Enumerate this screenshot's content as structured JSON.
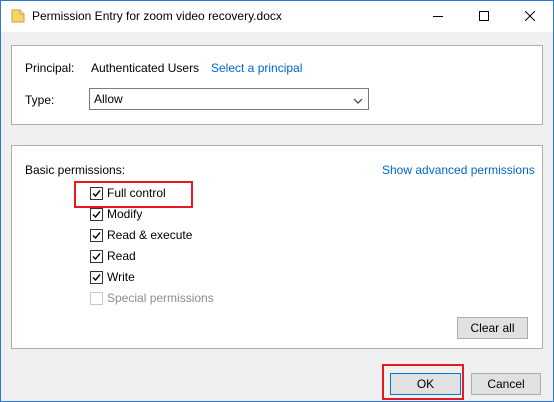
{
  "window": {
    "title": "Permission Entry for zoom video recovery.docx",
    "icons": {
      "app": "file-icon",
      "minimize": "minimize-icon",
      "maximize": "maximize-icon",
      "close": "close-icon"
    }
  },
  "principal": {
    "label": "Principal:",
    "value": "Authenticated Users",
    "link": "Select a principal"
  },
  "type": {
    "label": "Type:",
    "selected": "Allow"
  },
  "permissions": {
    "label": "Basic permissions:",
    "advanced_link": "Show advanced permissions",
    "items": [
      {
        "label": "Full control",
        "checked": true,
        "enabled": true
      },
      {
        "label": "Modify",
        "checked": true,
        "enabled": true
      },
      {
        "label": "Read & execute",
        "checked": true,
        "enabled": true
      },
      {
        "label": "Read",
        "checked": true,
        "enabled": true
      },
      {
        "label": "Write",
        "checked": true,
        "enabled": true
      },
      {
        "label": "Special permissions",
        "checked": false,
        "enabled": false
      }
    ],
    "clear_all": "Clear all"
  },
  "footer": {
    "ok": "OK",
    "cancel": "Cancel"
  },
  "colors": {
    "link": "#0066cc",
    "highlight": "#e5191f",
    "accent": "#0078d7"
  }
}
